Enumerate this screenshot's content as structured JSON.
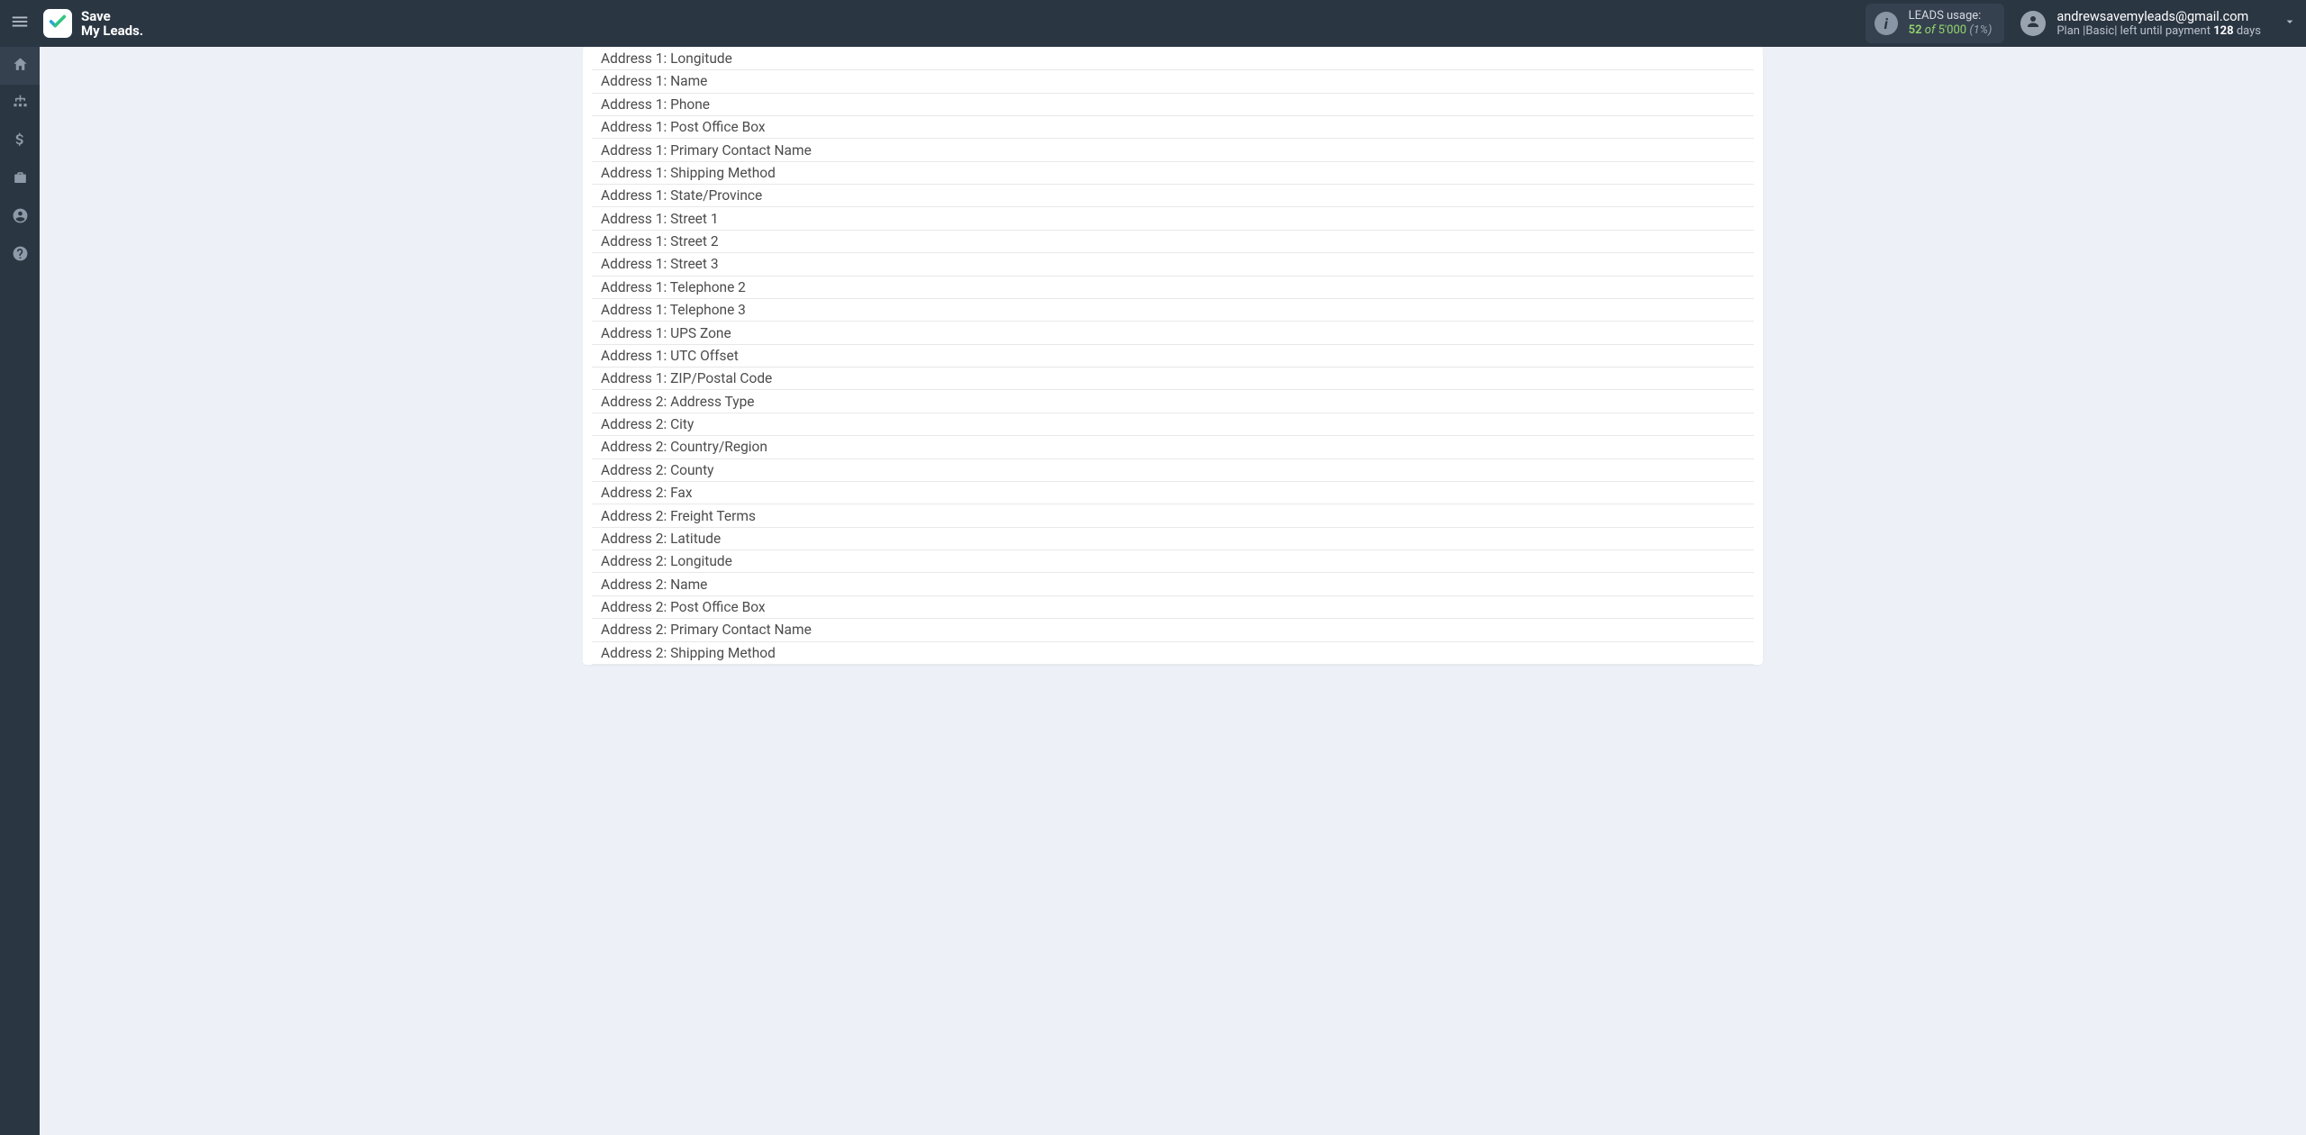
{
  "brand": {
    "line1": "Save",
    "line2": "My Leads."
  },
  "usage": {
    "label": "LEADS usage:",
    "used": "52",
    "of_word": "of",
    "total": "5'000",
    "percent": "(1%)"
  },
  "account": {
    "email": "andrewsavemyleads@gmail.com",
    "plan_prefix": "Plan |",
    "plan_name": "Basic",
    "plan_suffix": "| left until payment",
    "days_num": "128",
    "days_word": "days"
  },
  "fields": [
    "Address 1: Longitude",
    "Address 1: Name",
    "Address 1: Phone",
    "Address 1: Post Office Box",
    "Address 1: Primary Contact Name",
    "Address 1: Shipping Method",
    "Address 1: State/Province",
    "Address 1: Street 1",
    "Address 1: Street 2",
    "Address 1: Street 3",
    "Address 1: Telephone 2",
    "Address 1: Telephone 3",
    "Address 1: UPS Zone",
    "Address 1: UTC Offset",
    "Address 1: ZIP/Postal Code",
    "Address 2: Address Type",
    "Address 2: City",
    "Address 2: Country/Region",
    "Address 2: County",
    "Address 2: Fax",
    "Address 2: Freight Terms",
    "Address 2: Latitude",
    "Address 2: Longitude",
    "Address 2: Name",
    "Address 2: Post Office Box",
    "Address 2: Primary Contact Name",
    "Address 2: Shipping Method"
  ]
}
